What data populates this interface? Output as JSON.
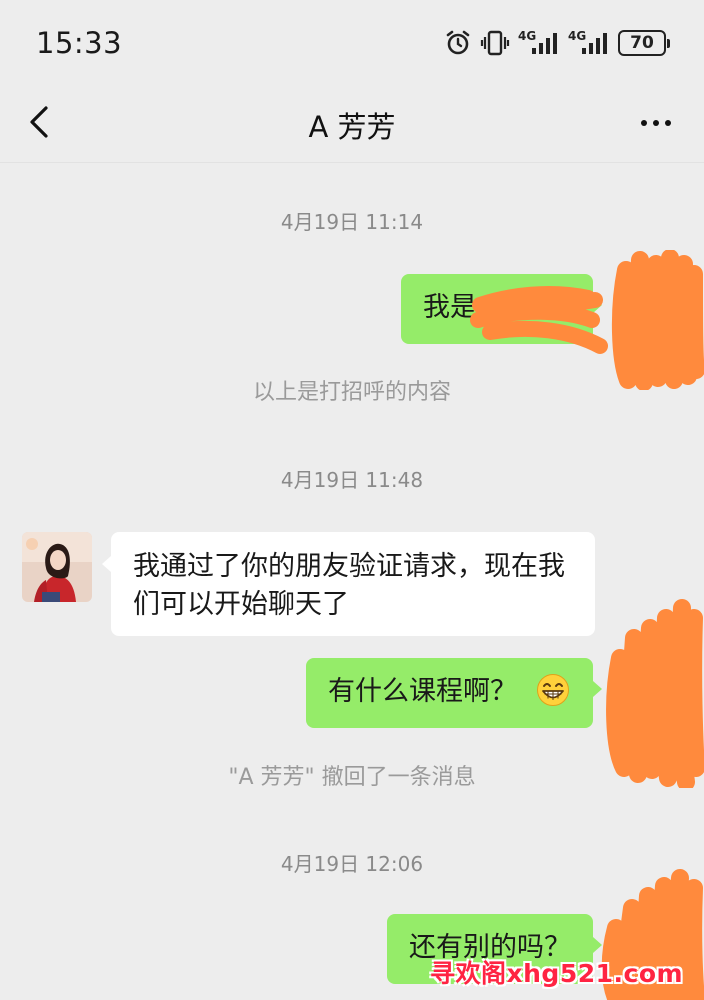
{
  "status_bar": {
    "time": "15:33",
    "battery": "70",
    "network_1": "4G",
    "network_2": "4G",
    "icons": [
      "alarm-icon",
      "vibrate-icon",
      "signal-icon",
      "signal-icon"
    ]
  },
  "header": {
    "title": "A 芳芳",
    "back_icon": "chevron-left-icon",
    "more_icon": "more-dots-icon"
  },
  "messages": {
    "time_1": "4月19日 11:14",
    "msg_1_visible": "我是",
    "system_1": "以上是打招呼的内容",
    "time_2": "4月19日 11:48",
    "msg_2": "我通过了你的朋友验证请求，现在我们可以开始聊天了",
    "msg_3": "有什么课程啊？",
    "msg_3_emoji": "grin-emoji",
    "system_2": "\"A 芳芳\" 撤回了一条消息",
    "time_3": "4月19日 12:06",
    "msg_4": "还有别的吗？"
  },
  "watermark": "寻欢阁xhg521.com",
  "colors": {
    "background": "#ededed",
    "my_bubble": "#95ec69",
    "their_bubble": "#ffffff",
    "redaction": "#ff8a3d",
    "watermark": "#ff2442"
  }
}
